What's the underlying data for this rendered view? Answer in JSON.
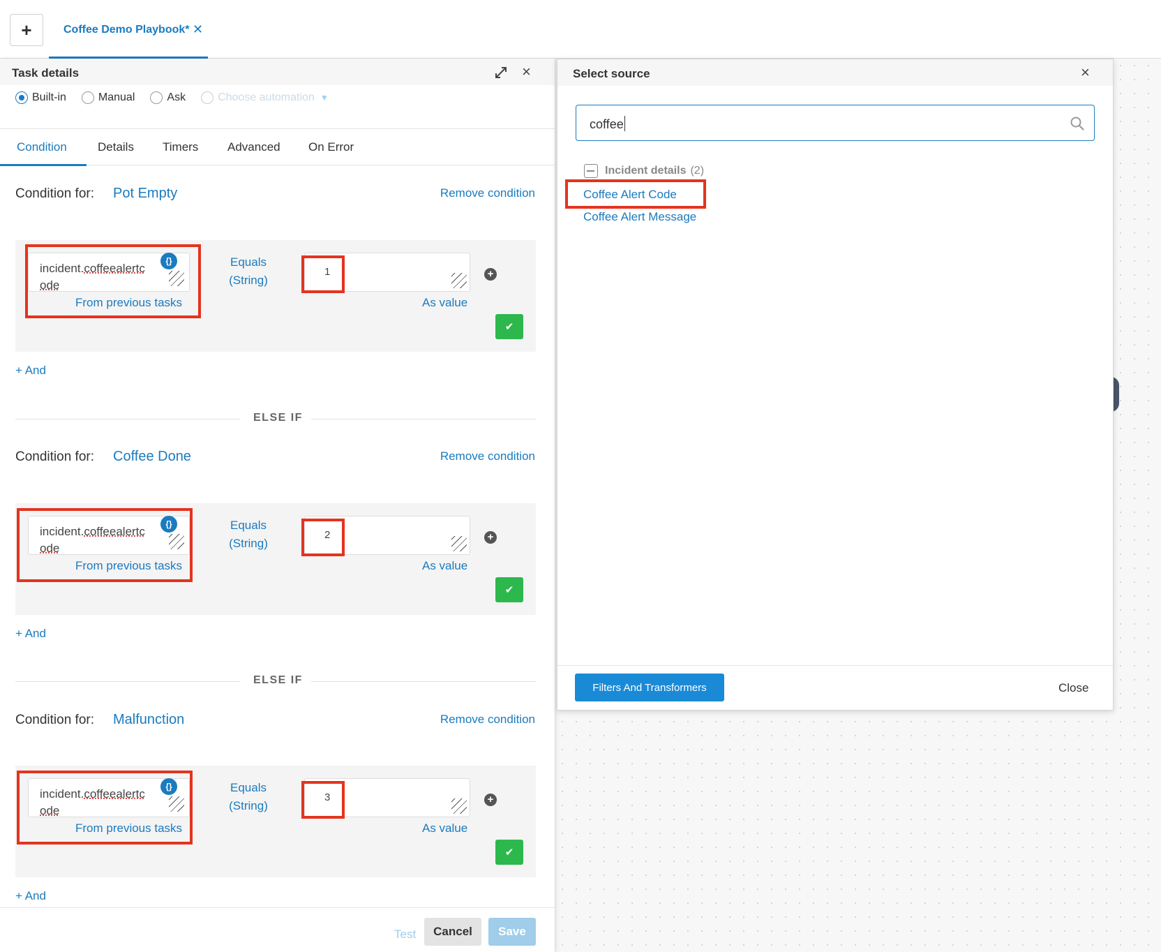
{
  "topbar": {
    "new_tab_symbol": "+",
    "tab_title": "Coffee Demo Playbook*",
    "tab_close_symbol": "✕"
  },
  "task_details": {
    "title": "Task details",
    "task_types": [
      {
        "label": "Built-in",
        "selected": true
      },
      {
        "label": "Manual",
        "selected": false
      },
      {
        "label": "Ask",
        "selected": false
      },
      {
        "label": "Choose automation",
        "selected": false,
        "disabled": true
      }
    ],
    "tabs": [
      "Condition",
      "Details",
      "Timers",
      "Advanced",
      "On Error"
    ],
    "active_tab": "Condition",
    "condition_for_label": "Condition for:",
    "remove_condition_label": "Remove condition",
    "and_label": "+ And",
    "else_if_label": "ELSE IF",
    "conditions": [
      {
        "name": "Pot Empty",
        "lhs_prefix": "incident.",
        "lhs_underlined": "coffeealertc",
        "lhs_wrap": "ode",
        "lhs_source": "From previous tasks",
        "operator_line1": "Equals",
        "operator_line2": "(String)",
        "rhs_value": "1",
        "rhs_source": "As value"
      },
      {
        "name": "Coffee Done",
        "lhs_prefix": "incident.",
        "lhs_underlined": "coffeealertc",
        "lhs_wrap": "ode",
        "lhs_source": "From previous tasks",
        "operator_line1": "Equals",
        "operator_line2": "(String)",
        "rhs_value": "2",
        "rhs_source": "As value"
      },
      {
        "name": "Malfunction",
        "lhs_prefix": "incident.",
        "lhs_underlined": "coffeealertc",
        "lhs_wrap": "ode",
        "lhs_source": "From previous tasks",
        "operator_line1": "Equals",
        "operator_line2": "(String)",
        "rhs_value": "3",
        "rhs_source": "As value"
      }
    ],
    "braces_symbol": "{}",
    "footer": {
      "test": "Test",
      "cancel": "Cancel",
      "save": "Save"
    }
  },
  "select_source": {
    "title": "Select source",
    "search_value": "coffee",
    "group": {
      "label": "Incident details",
      "count": "(2)"
    },
    "items": [
      "Coffee Alert Code",
      "Coffee Alert Message"
    ],
    "filters_button": "Filters And Transformers",
    "close_button": "Close"
  },
  "colors": {
    "accent": "#1a7bbf",
    "highlight": "#e3341f",
    "confirm": "#2db84d"
  },
  "icons": [
    "plus-icon",
    "close-icon",
    "expand-icon",
    "search-icon",
    "braces-icon",
    "check-icon",
    "minus-square-icon",
    "resize-handle-icon"
  ]
}
